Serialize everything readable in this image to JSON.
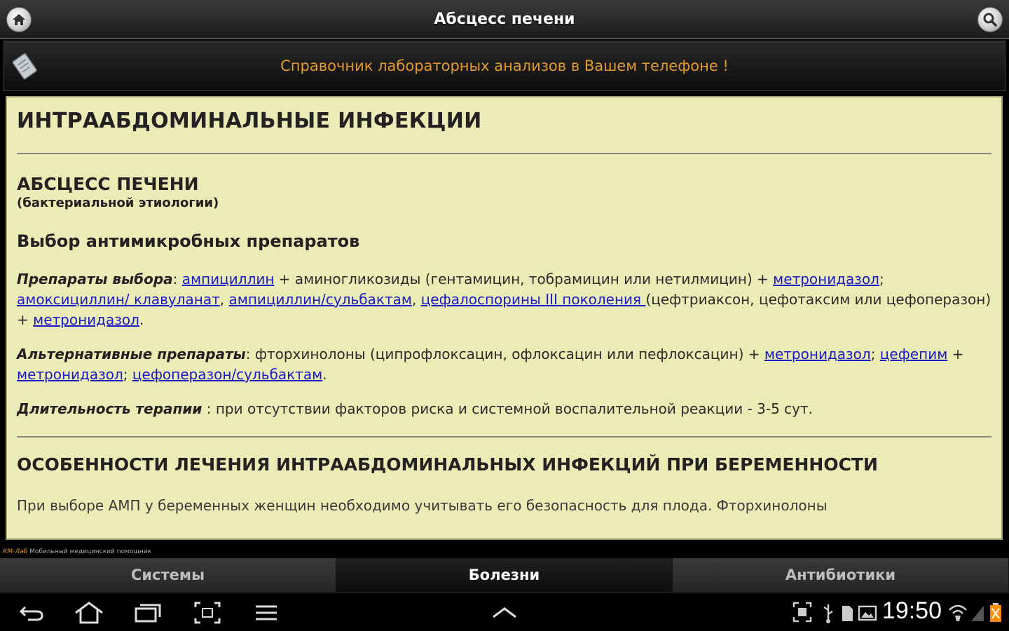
{
  "window": {
    "title": "Абсцесс печени"
  },
  "banner": {
    "text": "Справочник лабораторных анализов в Вашем телефоне !"
  },
  "content": {
    "section_title": "ИНТРААБДОМИНАЛЬНЫЕ ИНФЕКЦИИ",
    "disease_title": "АБСЦЕСС ПЕЧЕНИ",
    "disease_subtitle": "(бактериальной этиологии)",
    "choice_heading": "Выбор антимикробных препаратов",
    "p1": {
      "label": "Препараты выбора",
      "sep": ": ",
      "l1": "ампициллин",
      "t1": " + аминогликозиды (гентамицин, тобрамицин или нетилмицин) + ",
      "l2": "метронидазол",
      "t2": "; ",
      "l3": "амоксициллин/ клавуланат",
      "t3": ", ",
      "l4": "ампициллин/сульбактам",
      "t4": ", ",
      "l5": "цефалоспорины III поколения ",
      "t5": "(цефтриаксон, цефотаксим или цефоперазон) + ",
      "l6": "метронидазол",
      "t6": "."
    },
    "p2": {
      "label": "Альтернативные препараты",
      "sep": ": ",
      "t0": "фторхинолоны (ципрофлоксацин, офлоксацин или пефлоксацин) + ",
      "l1": "метронидазол",
      "t1": "; ",
      "l2": "цефепим",
      "t2": " + ",
      "l3": "метронидазол",
      "t3": "; ",
      "l4": "цефоперазон/сульбактам",
      "t4": "."
    },
    "p3": {
      "label": "Длительность терапии",
      "text": " : при отсутствии факторов риска и системной воспалительной реакции - 3-5 сут."
    },
    "section2_title": "ОСОБЕННОСТИ ЛЕЧЕНИЯ ИНТРААБДОМИНАЛЬНЫХ ИНФЕКЦИЙ ПРИ БЕРЕМЕННОСТИ",
    "section2_text": "При выборе АМП у беременных женщин необходимо учитывать его безопасность для плода. Фторхинолоны"
  },
  "footer": {
    "brand": "КМ-Лаб",
    "tagline": "Мобильный медицинский помощник"
  },
  "tabs": [
    {
      "label": "Системы",
      "active": false
    },
    {
      "label": "Болезни",
      "active": true
    },
    {
      "label": "Антибиотики",
      "active": false
    }
  ],
  "status": {
    "time": "19:50"
  },
  "colors": {
    "banner_text": "#e39a2b",
    "content_bg": "#ebebb5",
    "link": "#1a1ac8"
  },
  "icons": [
    "home-icon",
    "search-icon",
    "notepad-icon",
    "back-icon",
    "nav-home-icon",
    "recent-apps-icon",
    "screenshot-icon",
    "menu-icon",
    "chevron-up-icon",
    "resize-icon",
    "usb-icon",
    "sd-card-icon",
    "image-icon",
    "wifi-icon",
    "battery-icon"
  ]
}
